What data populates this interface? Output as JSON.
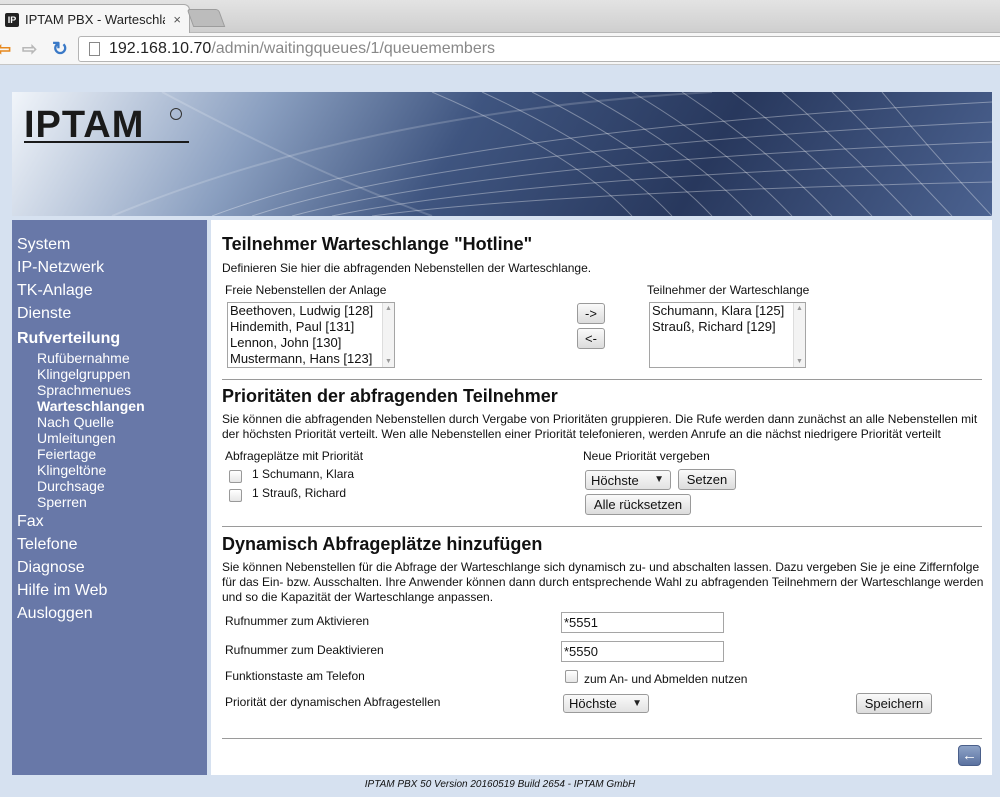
{
  "browser": {
    "tab_title": "IPTAM PBX - Warteschlange",
    "tab_close": "×",
    "url_host": "192.168.10.70",
    "url_path": "/admin/waitingqueues/1/queuemembers"
  },
  "logo": {
    "text": "IPTAM"
  },
  "sidebar": {
    "items": [
      {
        "label": "System"
      },
      {
        "label": "IP-Netzwerk"
      },
      {
        "label": "TK-Anlage"
      },
      {
        "label": "Dienste"
      },
      {
        "label": "Rufverteilung"
      },
      {
        "label": "Fax"
      },
      {
        "label": "Telefone"
      },
      {
        "label": "Diagnose"
      },
      {
        "label": "Hilfe im Web"
      },
      {
        "label": "Ausloggen"
      }
    ],
    "subitems": [
      {
        "label": "Rufübernahme"
      },
      {
        "label": "Klingelgruppen"
      },
      {
        "label": "Sprachmenues"
      },
      {
        "label": "Warteschlangen"
      },
      {
        "label": "Nach Quelle"
      },
      {
        "label": "Umleitungen"
      },
      {
        "label": "Feiertage"
      },
      {
        "label": "Klingeltöne"
      },
      {
        "label": "Durchsage"
      },
      {
        "label": "Sperren"
      }
    ]
  },
  "members": {
    "title": "Teilnehmer Warteschlange \"Hotline\"",
    "description": "Definieren Sie hier die abfragenden Nebenstellen der Warteschlange.",
    "free_label": "Freie Nebenstellen der Anlage",
    "free_list": [
      "Beethoven, Ludwig [128]",
      "Hindemith, Paul [131]",
      "Lennon, John [130]",
      "Mustermann, Hans [123]"
    ],
    "add_button": "->",
    "remove_button": "<-",
    "queue_label": "Teilnehmer der Warteschlange",
    "queue_list": [
      "Schumann, Klara [125]",
      "Strauß, Richard [129]"
    ]
  },
  "priorities": {
    "title": "Prioritäten der abfragenden Teilnehmer",
    "description": "Sie können die abfragenden Nebenstellen durch Vergabe von Prioritäten gruppieren. Die Rufe werden dann zunächst an alle Nebenstellen mit der höchsten Priorität verteilt. Wen alle Nebenstellen einer Priorität telefonieren, werden Anrufe an die nächst niedrigere Priorität verteilt",
    "list_label": "Abfrageplätze mit Priorität",
    "entries": [
      "1 Schumann, Klara",
      "1 Strauß, Richard"
    ],
    "new_label": "Neue Priorität vergeben",
    "select_value": "Höchste",
    "set_button": "Setzen",
    "reset_button": "Alle rücksetzen"
  },
  "dynamic": {
    "title": "Dynamisch Abfrageplätze hinzufügen",
    "description": "Sie können Nebenstellen für die Abfrage der Warteschlange sich dynamisch zu- und abschalten lassen. Dazu vergeben Sie je eine Ziffernfolge für das Ein- bzw. Ausschalten. Ihre Anwender können dann durch entsprechende Wahl zu abfragenden Teilnehmern der Warteschlange werden und so die Kapazität der Warteschlange anpassen.",
    "activate_label": "Rufnummer zum Aktivieren",
    "activate_value": "*5551",
    "deactivate_label": "Rufnummer zum Deaktivieren",
    "deactivate_value": "*5550",
    "function_key_label": "Funktionstaste am Telefon",
    "function_key_checkbox_label": "zum An- und Abmelden nutzen",
    "priority_label": "Priorität der dynamischen Abfragestellen",
    "priority_value": "Höchste",
    "save_button": "Speichern"
  },
  "footer": {
    "text": "IPTAM PBX 50 Version 20160519 Build 2654 - IPTAM GmbH"
  }
}
